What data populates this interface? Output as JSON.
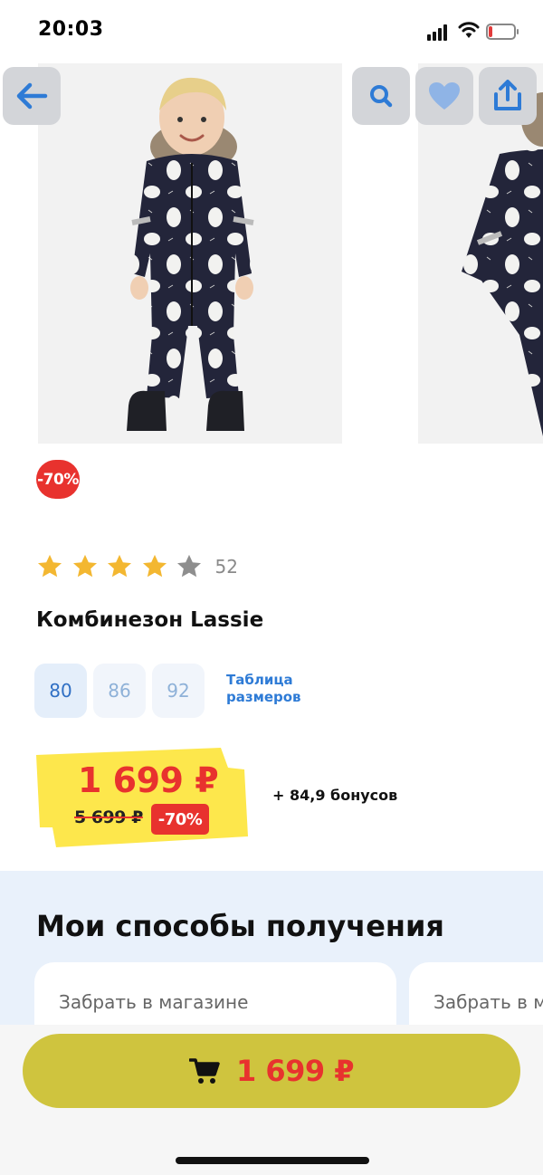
{
  "status_bar": {
    "time": "20:03",
    "battery_level": 0.15,
    "battery_color": "#e23b3b"
  },
  "gallery": {
    "photo_1_alt": "",
    "photo_2_alt": ""
  },
  "header_buttons": {
    "back_icon": "arrow-left-icon",
    "search_icon": "search-icon",
    "favorite_icon": "heart-icon",
    "share_icon": "share-icon"
  },
  "product": {
    "discount_badge": "-70%",
    "rating": 4,
    "rating_max": 5,
    "reviews_count": "52",
    "title": "Комбинезон Lassie",
    "sizes": [
      "80",
      "86",
      "92"
    ],
    "selected_size": "80",
    "size_table_link": "Таблица размеров",
    "price": "1 699 ₽",
    "old_price": "5 699 ₽",
    "discount": "-70%",
    "bonus": "+ 84,9 бонусов"
  },
  "delivery": {
    "title": "Мои способы получения",
    "options": [
      "Забрать в магазине",
      "Забрать в магазине"
    ]
  },
  "cart_button": {
    "price": "1 699 ₽",
    "icon": "cart-icon"
  },
  "colors": {
    "accent_red": "#e8322e",
    "price_tag_yellow": "#fde74c",
    "cart_button": "#cfc43e",
    "link_blue": "#2e7bd6",
    "header_button_bg": "#d3d5d9",
    "delivery_bg": "#e9f1fb"
  }
}
